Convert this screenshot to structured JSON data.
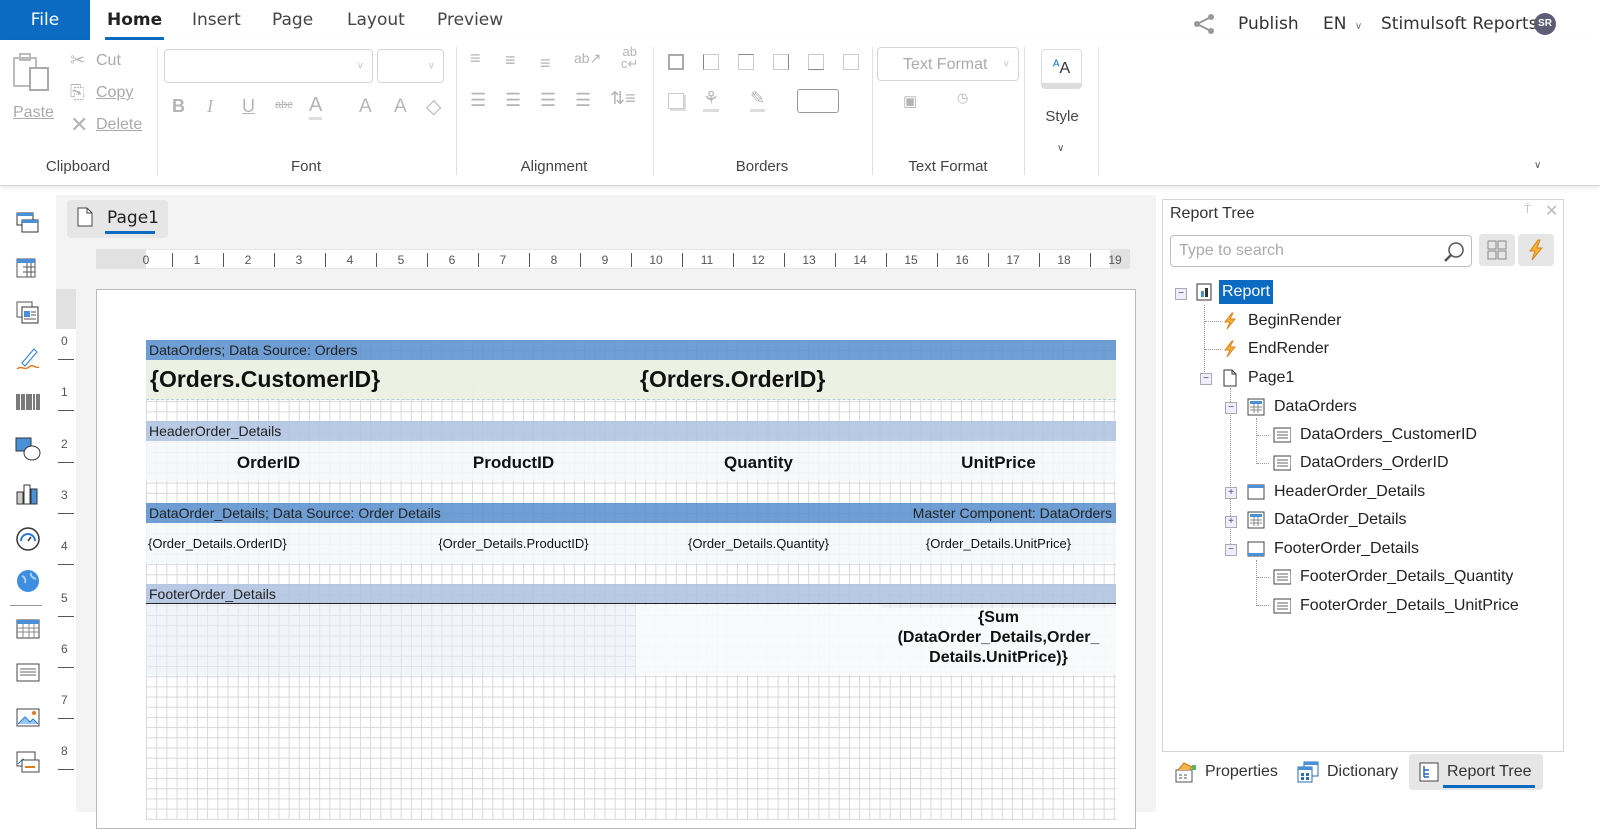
{
  "app": {
    "name": "Stimulsoft Reports",
    "user_initials": "SR",
    "language": "EN",
    "publish_label": "Publish"
  },
  "menu": {
    "file": "File",
    "tabs": [
      {
        "label": "Home",
        "active": true
      },
      {
        "label": "Insert",
        "active": false
      },
      {
        "label": "Page",
        "active": false
      },
      {
        "label": "Layout",
        "active": false
      },
      {
        "label": "Preview",
        "active": false
      }
    ]
  },
  "ribbon": {
    "clipboard": {
      "label": "Clipboard",
      "paste": "Paste",
      "cut": "Cut",
      "copy": "Copy",
      "delete": "Delete"
    },
    "font": {
      "label": "Font",
      "font_name": "",
      "font_size": "",
      "bold": "B",
      "italic": "I",
      "underline": "U",
      "strike": "abc",
      "color": "A",
      "grow": "A",
      "shrink": "A"
    },
    "alignment": {
      "label": "Alignment"
    },
    "borders": {
      "label": "Borders"
    },
    "text_format": {
      "label": "Text Format",
      "combo": "Text Format"
    },
    "style": {
      "label": "Style",
      "icon_text": "AA"
    }
  },
  "designer": {
    "page_tab": "Page1",
    "hruler": [
      "0",
      "1",
      "2",
      "3",
      "4",
      "5",
      "6",
      "7",
      "8",
      "9",
      "10",
      "11",
      "12",
      "13",
      "14",
      "15",
      "16",
      "17",
      "18",
      "19"
    ],
    "vruler": [
      "0",
      "1",
      "2",
      "3",
      "4",
      "5",
      "6",
      "7",
      "8"
    ],
    "bands": {
      "data_orders": {
        "header": "DataOrders; Data Source: Orders",
        "fields": [
          "{Orders.CustomerID}",
          "{Orders.OrderID}"
        ]
      },
      "header_order_details": {
        "header": "HeaderOrder_Details",
        "fields": [
          "OrderID",
          "ProductID",
          "Quantity",
          "UnitPrice"
        ]
      },
      "data_order_details": {
        "header": "DataOrder_Details; Data Source: Order Details",
        "master": "Master Component: DataOrders",
        "fields": [
          "{Order_Details.OrderID}",
          "{Order_Details.ProductID}",
          "{Order_Details.Quantity}",
          "{Order_Details.UnitPrice}"
        ]
      },
      "footer_order_details": {
        "header": "FooterOrder_Details",
        "sum_line1": "{Sum",
        "sum_line2": "(DataOrder_Details,Order_",
        "sum_line3": "Details.UnitPrice)}"
      }
    }
  },
  "report_tree": {
    "title": "Report Tree",
    "search_placeholder": "Type to search",
    "items": [
      {
        "label": "Report",
        "icon": "report-icon",
        "selected": true
      },
      {
        "label": "BeginRender",
        "icon": "event-icon"
      },
      {
        "label": "EndRender",
        "icon": "event-icon"
      },
      {
        "label": "Page1",
        "icon": "page-icon"
      },
      {
        "label": "DataOrders",
        "icon": "databand-icon"
      },
      {
        "label": "DataOrders_CustomerID",
        "icon": "text-icon"
      },
      {
        "label": "DataOrders_OrderID",
        "icon": "text-icon"
      },
      {
        "label": "HeaderOrder_Details",
        "icon": "headerband-icon"
      },
      {
        "label": "DataOrder_Details",
        "icon": "databand-icon"
      },
      {
        "label": "FooterOrder_Details",
        "icon": "footerband-icon"
      },
      {
        "label": "FooterOrder_Details_Quantity",
        "icon": "text-icon"
      },
      {
        "label": "FooterOrder_Details_UnitPrice",
        "icon": "text-icon"
      }
    ]
  },
  "panel_tabs": [
    {
      "label": "Properties",
      "active": false
    },
    {
      "label": "Dictionary",
      "active": false
    },
    {
      "label": "Report Tree",
      "active": true
    }
  ],
  "colors": {
    "accent": "#0b6bc2",
    "band_dark": "#6a9fd4",
    "band_light": "#b7c8e2",
    "event_orange": "#f0a030"
  }
}
